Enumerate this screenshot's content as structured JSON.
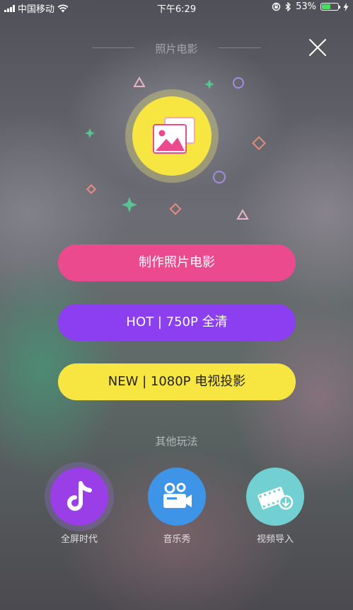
{
  "status_bar": {
    "carrier": "中国移动",
    "time": "下午6:29",
    "battery": "53%",
    "battery_level": 0.53
  },
  "header": {
    "title": "照片电影"
  },
  "buttons": {
    "make": "制作照片电影",
    "hot": "HOT | 750P 全清",
    "new": "NEW | 1080P 电视投影"
  },
  "other": {
    "label": "其他玩法",
    "items": [
      {
        "label": "全屏时代",
        "icon": "tiktok-note-icon"
      },
      {
        "label": "音乐秀",
        "icon": "video-camera-icon"
      },
      {
        "label": "视频导入",
        "icon": "film-import-icon"
      }
    ]
  },
  "colors": {
    "pink": "#ec4a8e",
    "purple": "#8b3ff0",
    "yellow": "#f7e642",
    "blue": "#3e95e8",
    "teal": "#72d0d2"
  }
}
